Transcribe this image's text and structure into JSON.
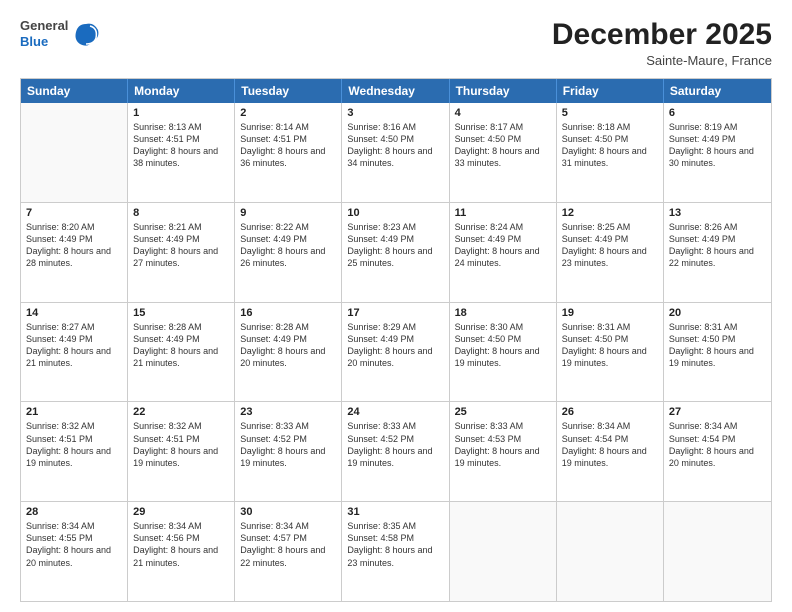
{
  "header": {
    "logo": {
      "general": "General",
      "blue": "Blue"
    },
    "title": "December 2025",
    "subtitle": "Sainte-Maure, France"
  },
  "days": [
    "Sunday",
    "Monday",
    "Tuesday",
    "Wednesday",
    "Thursday",
    "Friday",
    "Saturday"
  ],
  "weeks": [
    [
      {
        "day": "",
        "sunrise": "",
        "sunset": "",
        "daylight": "",
        "empty": true
      },
      {
        "day": "1",
        "sunrise": "Sunrise: 8:13 AM",
        "sunset": "Sunset: 4:51 PM",
        "daylight": "Daylight: 8 hours and 38 minutes."
      },
      {
        "day": "2",
        "sunrise": "Sunrise: 8:14 AM",
        "sunset": "Sunset: 4:51 PM",
        "daylight": "Daylight: 8 hours and 36 minutes."
      },
      {
        "day": "3",
        "sunrise": "Sunrise: 8:16 AM",
        "sunset": "Sunset: 4:50 PM",
        "daylight": "Daylight: 8 hours and 34 minutes."
      },
      {
        "day": "4",
        "sunrise": "Sunrise: 8:17 AM",
        "sunset": "Sunset: 4:50 PM",
        "daylight": "Daylight: 8 hours and 33 minutes."
      },
      {
        "day": "5",
        "sunrise": "Sunrise: 8:18 AM",
        "sunset": "Sunset: 4:50 PM",
        "daylight": "Daylight: 8 hours and 31 minutes."
      },
      {
        "day": "6",
        "sunrise": "Sunrise: 8:19 AM",
        "sunset": "Sunset: 4:49 PM",
        "daylight": "Daylight: 8 hours and 30 minutes."
      }
    ],
    [
      {
        "day": "7",
        "sunrise": "Sunrise: 8:20 AM",
        "sunset": "Sunset: 4:49 PM",
        "daylight": "Daylight: 8 hours and 28 minutes."
      },
      {
        "day": "8",
        "sunrise": "Sunrise: 8:21 AM",
        "sunset": "Sunset: 4:49 PM",
        "daylight": "Daylight: 8 hours and 27 minutes."
      },
      {
        "day": "9",
        "sunrise": "Sunrise: 8:22 AM",
        "sunset": "Sunset: 4:49 PM",
        "daylight": "Daylight: 8 hours and 26 minutes."
      },
      {
        "day": "10",
        "sunrise": "Sunrise: 8:23 AM",
        "sunset": "Sunset: 4:49 PM",
        "daylight": "Daylight: 8 hours and 25 minutes."
      },
      {
        "day": "11",
        "sunrise": "Sunrise: 8:24 AM",
        "sunset": "Sunset: 4:49 PM",
        "daylight": "Daylight: 8 hours and 24 minutes."
      },
      {
        "day": "12",
        "sunrise": "Sunrise: 8:25 AM",
        "sunset": "Sunset: 4:49 PM",
        "daylight": "Daylight: 8 hours and 23 minutes."
      },
      {
        "day": "13",
        "sunrise": "Sunrise: 8:26 AM",
        "sunset": "Sunset: 4:49 PM",
        "daylight": "Daylight: 8 hours and 22 minutes."
      }
    ],
    [
      {
        "day": "14",
        "sunrise": "Sunrise: 8:27 AM",
        "sunset": "Sunset: 4:49 PM",
        "daylight": "Daylight: 8 hours and 21 minutes."
      },
      {
        "day": "15",
        "sunrise": "Sunrise: 8:28 AM",
        "sunset": "Sunset: 4:49 PM",
        "daylight": "Daylight: 8 hours and 21 minutes."
      },
      {
        "day": "16",
        "sunrise": "Sunrise: 8:28 AM",
        "sunset": "Sunset: 4:49 PM",
        "daylight": "Daylight: 8 hours and 20 minutes."
      },
      {
        "day": "17",
        "sunrise": "Sunrise: 8:29 AM",
        "sunset": "Sunset: 4:49 PM",
        "daylight": "Daylight: 8 hours and 20 minutes."
      },
      {
        "day": "18",
        "sunrise": "Sunrise: 8:30 AM",
        "sunset": "Sunset: 4:50 PM",
        "daylight": "Daylight: 8 hours and 19 minutes."
      },
      {
        "day": "19",
        "sunrise": "Sunrise: 8:31 AM",
        "sunset": "Sunset: 4:50 PM",
        "daylight": "Daylight: 8 hours and 19 minutes."
      },
      {
        "day": "20",
        "sunrise": "Sunrise: 8:31 AM",
        "sunset": "Sunset: 4:50 PM",
        "daylight": "Daylight: 8 hours and 19 minutes."
      }
    ],
    [
      {
        "day": "21",
        "sunrise": "Sunrise: 8:32 AM",
        "sunset": "Sunset: 4:51 PM",
        "daylight": "Daylight: 8 hours and 19 minutes."
      },
      {
        "day": "22",
        "sunrise": "Sunrise: 8:32 AM",
        "sunset": "Sunset: 4:51 PM",
        "daylight": "Daylight: 8 hours and 19 minutes."
      },
      {
        "day": "23",
        "sunrise": "Sunrise: 8:33 AM",
        "sunset": "Sunset: 4:52 PM",
        "daylight": "Daylight: 8 hours and 19 minutes."
      },
      {
        "day": "24",
        "sunrise": "Sunrise: 8:33 AM",
        "sunset": "Sunset: 4:52 PM",
        "daylight": "Daylight: 8 hours and 19 minutes."
      },
      {
        "day": "25",
        "sunrise": "Sunrise: 8:33 AM",
        "sunset": "Sunset: 4:53 PM",
        "daylight": "Daylight: 8 hours and 19 minutes."
      },
      {
        "day": "26",
        "sunrise": "Sunrise: 8:34 AM",
        "sunset": "Sunset: 4:54 PM",
        "daylight": "Daylight: 8 hours and 19 minutes."
      },
      {
        "day": "27",
        "sunrise": "Sunrise: 8:34 AM",
        "sunset": "Sunset: 4:54 PM",
        "daylight": "Daylight: 8 hours and 20 minutes."
      }
    ],
    [
      {
        "day": "28",
        "sunrise": "Sunrise: 8:34 AM",
        "sunset": "Sunset: 4:55 PM",
        "daylight": "Daylight: 8 hours and 20 minutes."
      },
      {
        "day": "29",
        "sunrise": "Sunrise: 8:34 AM",
        "sunset": "Sunset: 4:56 PM",
        "daylight": "Daylight: 8 hours and 21 minutes."
      },
      {
        "day": "30",
        "sunrise": "Sunrise: 8:34 AM",
        "sunset": "Sunset: 4:57 PM",
        "daylight": "Daylight: 8 hours and 22 minutes."
      },
      {
        "day": "31",
        "sunrise": "Sunrise: 8:35 AM",
        "sunset": "Sunset: 4:58 PM",
        "daylight": "Daylight: 8 hours and 23 minutes."
      },
      {
        "day": "",
        "sunrise": "",
        "sunset": "",
        "daylight": "",
        "empty": true
      },
      {
        "day": "",
        "sunrise": "",
        "sunset": "",
        "daylight": "",
        "empty": true
      },
      {
        "day": "",
        "sunrise": "",
        "sunset": "",
        "daylight": "",
        "empty": true
      }
    ]
  ]
}
